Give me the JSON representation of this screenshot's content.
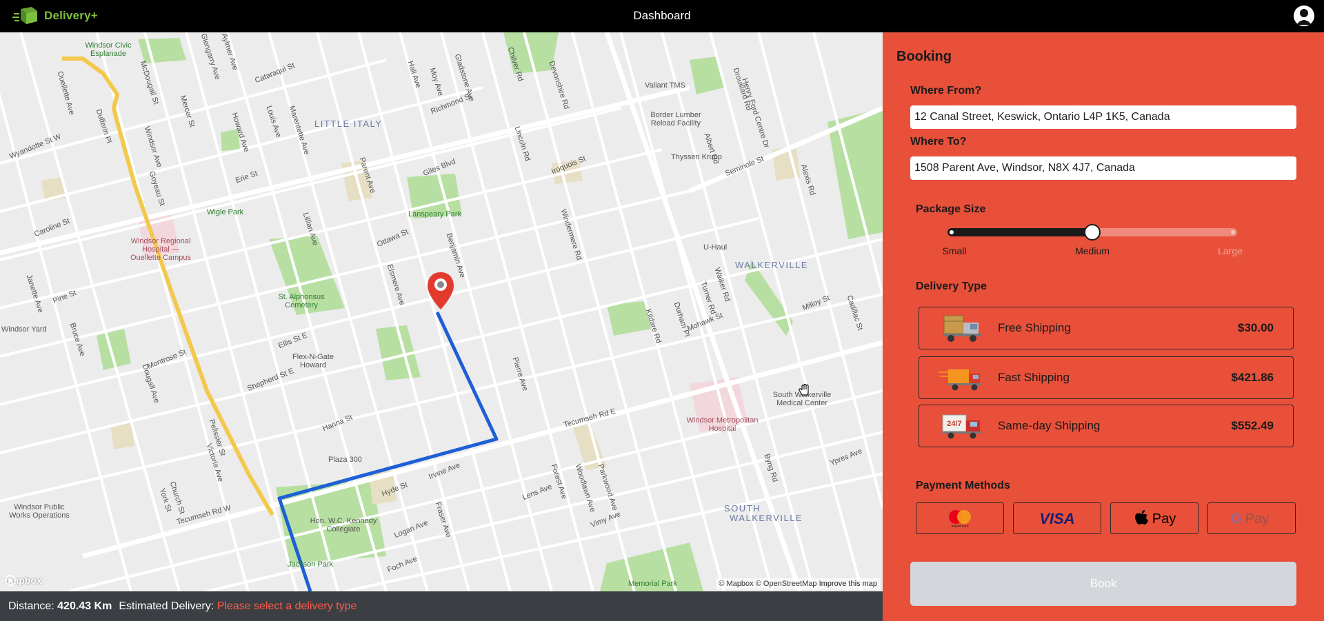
{
  "app": {
    "brand": "Delivery+",
    "title": "Dashboard"
  },
  "map": {
    "areas": [
      "LITTLE ITALY",
      "WALKERVILLE",
      "SOUTH",
      "WALKERVILLE"
    ],
    "streets": [
      "Ouellette Ave",
      "Dufferin Pl",
      "Windsor Ave",
      "Goyeau St",
      "McDougall St",
      "Mercer St",
      "Howard Ave",
      "Louis Ave",
      "Marentette Ave",
      "Parent Ave",
      "Lillian Ave",
      "Elsmere Ave",
      "Benjamin Ave",
      "Pierre Ave",
      "Hall Ave",
      "Moy Ave",
      "Gladstone Ave",
      "Lincoln Rd",
      "Windermere Rd",
      "Devonshire Rd",
      "Chilver Rd",
      "Kildare Rd",
      "Walker Rd",
      "Turner Rd",
      "Drouillard Rd",
      "Albert Rd",
      "Erie St",
      "Ottawa St",
      "Giles Blvd",
      "Tecumseh Rd E",
      "Tecumseh Rd W",
      "Seminole St",
      "Cataraqui St",
      "Richmond St",
      "Iroquois St",
      "Hanna St",
      "Shepherd St E",
      "Ellis St E",
      "Montrose St",
      "Pine St",
      "Caroline St",
      "Wyandotte St W",
      "Mohawk St",
      "Milloy St",
      "Ypres Ave",
      "Irvine Ave",
      "Lens Ave",
      "Logan Ave",
      "Foch Ave",
      "Vimy Ave",
      "Fraser Ave",
      "Hyde St",
      "Durham Pl",
      "Byng Rd",
      "Forest Ave",
      "Woodlawn Ave",
      "Parkwood Ave",
      "Janette Ave",
      "Bruce Ave",
      "Dougall Ave",
      "Victoria Ave",
      "Pelissier St",
      "Church St",
      "York St",
      "Henry Ford Centre Dr",
      "Alexis Rd",
      "Cadillac St",
      "Lens Ave",
      "Glengarry Ave",
      "Aylmer Ave"
    ],
    "places": {
      "parks": [
        "Windsor Civic Esplanade",
        "Wigle Park",
        "Lanspeary Park",
        "St. Alphonsus Cemetery",
        "Jackson Park",
        "Memorial Park"
      ],
      "hospitals": [
        "Windsor Regional Hospital — Ouellette Campus",
        "Windsor Metropolitan Hospital"
      ],
      "others": [
        "Valiant TMS",
        "Border Lumber Reload Facility",
        "Thyssen Krupp",
        "U-Haul",
        "Flex-N-Gate Howard",
        "Plaza 300",
        "Hon. W.C. Kennedy Collegiate",
        "Windsor Yard",
        "Windsor Public Works Operations",
        "South Walkerville Medical Center"
      ]
    },
    "logo": "mapbox",
    "attribution": {
      "mapbox": "© Mapbox",
      "osm": "© OpenStreetMap",
      "improve": "Improve this map"
    }
  },
  "status": {
    "distance_label": "Distance:",
    "distance_value": "420.43 Km",
    "eta_label": "Estimated Delivery:",
    "eta_value": "Please select a delivery type",
    "warn_color": "#ff5a4a"
  },
  "booking": {
    "heading": "Booking",
    "from_label": "Where From?",
    "from_value": "12 Canal Street, Keswick, Ontario L4P 1K5, Canada",
    "to_label": "Where To?",
    "to_value": "1508 Parent Ave, Windsor, N8X 4J7, Canada",
    "package_label": "Package Size",
    "package_ticks": [
      "Small",
      "Medium",
      "Large"
    ],
    "package_level": 0.5,
    "delivery_label": "Delivery Type",
    "delivery_options": [
      {
        "name": "Free Shipping",
        "price": "$30.00",
        "icon": "cargo-truck-icon"
      },
      {
        "name": "Fast Shipping",
        "price": "$421.86",
        "icon": "fast-truck-icon"
      },
      {
        "name": "Same-day Shipping",
        "price": "$552.49",
        "icon": "24-7-truck-icon"
      }
    ],
    "payment_label": "Payment Methods",
    "payment_methods": [
      {
        "name": "mastercard",
        "icon": "mastercard-icon"
      },
      {
        "name": "VISA",
        "icon": "visa-icon"
      },
      {
        "name": "Pay",
        "icon": "apple-pay-icon"
      },
      {
        "name": "Pay",
        "icon": "google-pay-icon"
      }
    ],
    "book_label": "Book",
    "accent": "#e8503a"
  }
}
